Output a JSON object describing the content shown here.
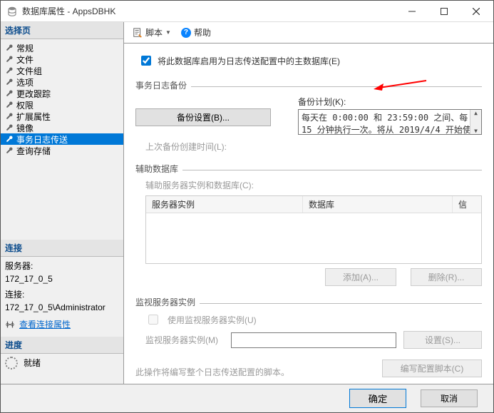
{
  "window": {
    "title": "数据库属性 - AppsDBHK"
  },
  "sidebar": {
    "select_page": "选择页",
    "items": [
      {
        "label": "常规"
      },
      {
        "label": "文件"
      },
      {
        "label": "文件组"
      },
      {
        "label": "选项"
      },
      {
        "label": "更改跟踪"
      },
      {
        "label": "权限"
      },
      {
        "label": "扩展属性"
      },
      {
        "label": "镜像"
      },
      {
        "label": "事务日志传送",
        "selected": true
      },
      {
        "label": "查询存储"
      }
    ],
    "connection": {
      "heading": "连接",
      "server_label": "服务器:",
      "server_value": "172_17_0_5",
      "conn_label": "连接:",
      "conn_value": "172_17_0_5\\Administrator",
      "view_props": "查看连接属性"
    },
    "progress": {
      "heading": "进度",
      "status": "就绪"
    }
  },
  "toolbar": {
    "script": "脚本",
    "help": "帮助"
  },
  "main": {
    "enable_checkbox": "将此数据库启用为日志传送配置中的主数据库(E)",
    "backup_group": "事务日志备份",
    "backup_settings_btn": "备份设置(B)...",
    "backup_schedule_label": "备份计划(K):",
    "backup_schedule_text": "每天在 0:00:00 和 23:59:00 之间、每 15 分钟执行一次。将从 2019/4/4 开始使",
    "last_backup_label": "上次备份创建时间(L):",
    "secondary_group": "辅助数据库",
    "secondary_label": "辅助服务器实例和数据库(C):",
    "col_server": "服务器实例",
    "col_db": "数据库",
    "col_trust": "信",
    "add_btn": "添加(A)...",
    "remove_btn": "删除(R)...",
    "monitor_group": "监视服务器实例",
    "use_monitor": "使用监视服务器实例(U)",
    "monitor_label": "监视服务器实例(M)",
    "settings_btn": "设置(S)...",
    "note": "此操作将编写整个日志传送配置的脚本。",
    "write_script_btn": "编写配置脚本(C)"
  },
  "buttons": {
    "ok": "确定",
    "cancel": "取消"
  }
}
